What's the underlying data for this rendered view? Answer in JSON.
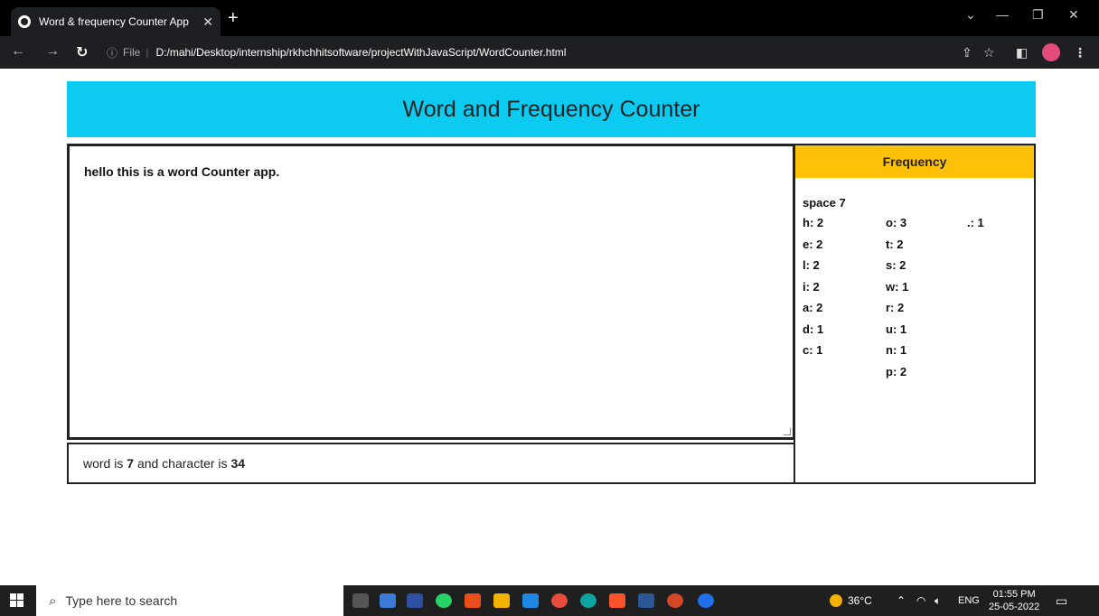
{
  "browser": {
    "tab_title": "Word & frequency Counter App",
    "tab_close": "✕",
    "new_tab": "+",
    "url_scheme_label": "File",
    "url": "D:/mahi/Desktop/internship/rkhchhitsoftware/projectWithJavaScript/WordCounter.html"
  },
  "app": {
    "title": "Word and Frequency Counter",
    "textarea_value": "hello this is a word Counter app.",
    "count": {
      "prefix": "word is",
      "words": "7",
      "middle": "and character is",
      "chars": "34"
    },
    "frequency": {
      "heading": "Frequency",
      "space": "space 7",
      "col1": [
        "h: 2",
        "e: 2",
        "l: 2",
        "i: 2",
        "a: 2",
        "d: 1",
        "c: 1"
      ],
      "col2": [
        "o: 3",
        "t: 2",
        "s: 2",
        "w: 1",
        "r: 2",
        "u: 1",
        "n: 1",
        "p: 2"
      ],
      "col3": [
        ".: 1"
      ]
    }
  },
  "taskbar": {
    "search_placeholder": "Type here to search",
    "weather": "36°C",
    "lang": "ENG",
    "time": "01:55 PM",
    "date": "25-05-2022"
  },
  "colors": {
    "header_bg": "#0dcaf0",
    "freq_header_bg": "#ffc107"
  }
}
